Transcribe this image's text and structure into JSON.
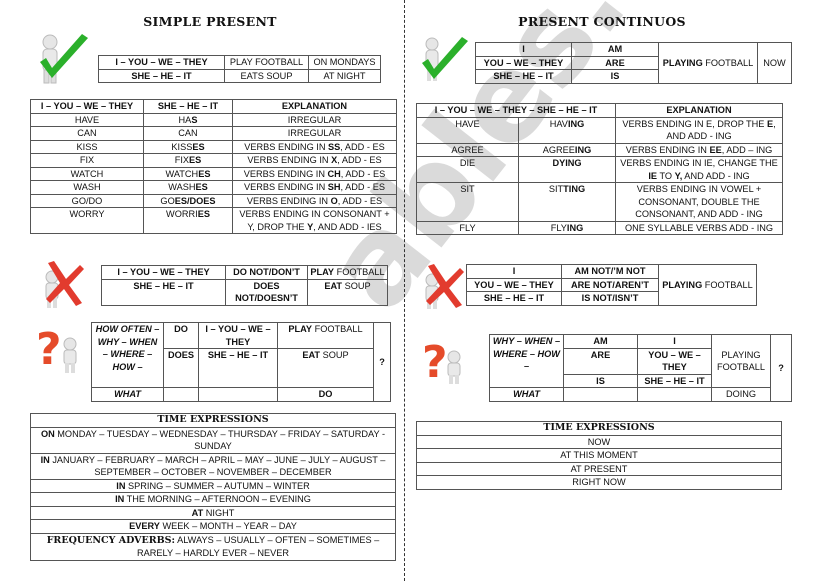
{
  "left": {
    "title": "SIMPLE PRESENT",
    "affirmative": {
      "icon": "person-checkmark-icon",
      "rows": [
        [
          "I – YOU – WE – THEY",
          "PLAY FOOTBALL",
          "ON MONDAYS"
        ],
        [
          "SHE – HE – IT",
          "EATS SOUP",
          "AT NIGHT"
        ]
      ]
    },
    "rules": {
      "headers": [
        "I – YOU – WE – THEY",
        "SHE – HE – IT",
        "EXPLANATION"
      ],
      "rows": [
        {
          "base": "HAVE",
          "third_stem": "HA",
          "third_end": "S",
          "exp_pre": "IRREGULAR",
          "exp_bold": "",
          "exp_post": ""
        },
        {
          "base": "CAN",
          "third_stem": "CAN",
          "third_end": "",
          "exp_pre": "IRREGULAR",
          "exp_bold": "",
          "exp_post": ""
        },
        {
          "base": "KISS",
          "third_stem": "KISS",
          "third_end": "ES",
          "exp_pre": "VERBS ENDING IN ",
          "exp_bold": "SS",
          "exp_post": ", ADD - ES"
        },
        {
          "base": "FIX",
          "third_stem": "FIX",
          "third_end": "ES",
          "exp_pre": "VERBS ENDING IN ",
          "exp_bold": "X",
          "exp_post": ", ADD - ES"
        },
        {
          "base": "WATCH",
          "third_stem": "WATCH",
          "third_end": "ES",
          "exp_pre": "VERBS ENDING IN ",
          "exp_bold": "CH",
          "exp_post": ", ADD - ES"
        },
        {
          "base": "WASH",
          "third_stem": "WASH",
          "third_end": "ES",
          "exp_pre": "VERBS ENDING IN ",
          "exp_bold": "SH",
          "exp_post": ", ADD - ES"
        },
        {
          "base": "GO/DO",
          "third_stem": "GO",
          "third_end": "ES/DOES",
          "exp_pre": "VERBS ENDING IN ",
          "exp_bold": "O",
          "exp_post": ", ADD - ES"
        },
        {
          "base": "WORRY",
          "third_stem": "WORRI",
          "third_end": "ES",
          "exp_pre": "VERBS ENDING IN CONSONANT + Y, DROP THE ",
          "exp_bold": "Y",
          "exp_post": ", AND ADD - IES"
        }
      ]
    },
    "negative": {
      "icon": "person-red-x-icon",
      "row1": {
        "subject": "I – YOU – WE – THEY",
        "aux": "DO NOT/DON’T",
        "verb_bold": "PLAY",
        "verb_rest": " FOOTBALL"
      },
      "row2": {
        "subject": "SHE – HE – IT",
        "aux": "DOES NOT/DOESN’T",
        "verb_bold": "EAT",
        "verb_rest": " SOUP"
      }
    },
    "question": {
      "icon": "person-question-mark-icon",
      "wh": "HOW OFTEN – WHY – WHEN – WHERE – HOW –",
      "wh_what": "WHAT",
      "aux1": "DO",
      "aux2": "DOES",
      "subj1": "I – YOU – WE – THEY",
      "subj2": "SHE – HE – IT",
      "verb1_bold": "PLAY",
      "verb1_rest": " FOOTBALL",
      "verb2_bold": "EAT",
      "verb2_rest": " SOUP",
      "what_verb": "DO",
      "qmark": "?"
    },
    "time": {
      "header": "TIME EXPRESSIONS",
      "rows": [
        {
          "bold": "ON",
          "rest": " MONDAY – TUESDAY – WEDNESDAY – THURSDAY – FRIDAY – SATURDAY - SUNDAY"
        },
        {
          "bold": "IN",
          "rest": " JANUARY – FEBRUARY – MARCH – APRIL – MAY – JUNE – JULY – AUGUST – SEPTEMBER – OCTOBER – NOVEMBER – DECEMBER"
        },
        {
          "bold": "IN",
          "rest": " SPRING – SUMMER – AUTUMN – WINTER"
        },
        {
          "bold": "IN",
          "rest": " THE MORNING – AFTERNOON – EVENING"
        },
        {
          "bold": "AT",
          "rest": " NIGHT"
        },
        {
          "bold": "EVERY",
          "rest": " WEEK – MONTH – YEAR – DAY"
        }
      ],
      "freq_label": "FREQUENCY ADVERBS:",
      "freq_rest": " ALWAYS – USUALLY – OFTEN – SOMETIMES – RARELY – HARDLY EVER – NEVER"
    }
  },
  "right": {
    "title": "PRESENT CONTINUOS",
    "affirmative": {
      "icon": "person-checkmark-icon",
      "subjects": [
        "I",
        "YOU – WE – THEY",
        "SHE – HE – IT"
      ],
      "aux": [
        "AM",
        "ARE",
        "IS"
      ],
      "verb_bold": "PLAYING",
      "verb_rest": " FOOTBALL",
      "time": "NOW"
    },
    "rules": {
      "header1": "I – YOU – WE – THEY – SHE – HE – IT",
      "header2": "EXPLANATION",
      "rows": [
        {
          "base": "HAVE",
          "ing_stem": "HAV",
          "ing_end": "ING",
          "exp": [
            [
              "VERBS ENDING IN E, DROP THE ",
              ""
            ],
            [
              "E",
              "b"
            ],
            [
              ", AND ADD - ING",
              ""
            ]
          ]
        },
        {
          "base": "AGREE",
          "ing_stem": "AGREE",
          "ing_end": "ING",
          "exp": [
            [
              "VERBS ENDING IN ",
              ""
            ],
            [
              "EE",
              "b"
            ],
            [
              ", ADD – ING",
              ""
            ]
          ]
        },
        {
          "base": "DIE",
          "ing_stem": "",
          "ing_end": "DYING",
          "exp": [
            [
              "VERBS ENDING IN IE, CHANGE THE ",
              ""
            ],
            [
              "IE",
              "b"
            ],
            [
              " TO ",
              ""
            ],
            [
              "Y,",
              "b"
            ],
            [
              " AND ADD - ING",
              ""
            ]
          ]
        },
        {
          "base": "SIT",
          "ing_stem": "SIT",
          "ing_end": "TING",
          "exp": [
            [
              "VERBS ENDING IN VOWEL + CONSONANT, DOUBLE THE CONSONANT, AND ADD - ING",
              ""
            ]
          ]
        },
        {
          "base": "FLY",
          "ing_stem": "FLY",
          "ing_end": "ING",
          "exp": [
            [
              "ONE SYLLABLE VERBS ADD - ING",
              ""
            ]
          ]
        }
      ]
    },
    "negative": {
      "icon": "person-red-x-icon",
      "subjects": [
        "I",
        "YOU – WE – THEY",
        "SHE – HE – IT"
      ],
      "aux": [
        "AM NOT/’M NOT",
        "ARE NOT/AREN’T",
        "IS NOT/ISN’T"
      ],
      "verb_bold": "PLAYING",
      "verb_rest": " FOOTBALL"
    },
    "question": {
      "icon": "person-question-mark-icon",
      "wh": "WHY – WHEN – WHERE – HOW –",
      "wh_what": "WHAT",
      "aux": [
        "AM",
        "ARE",
        "IS"
      ],
      "subjects": [
        "I",
        "YOU – WE – THEY",
        "SHE – HE – IT"
      ],
      "verb_bold": "PLAYING",
      "verb_rest": " FOOTBALL",
      "what_verb": "DOING",
      "qmark": "?"
    },
    "time": {
      "header": "TIME EXPRESSIONS",
      "rows": [
        "NOW",
        "AT THIS MOMENT",
        "AT PRESENT",
        "RIGHT NOW"
      ]
    }
  },
  "watermark": "ESLprintables.com",
  "colors": {
    "check": "#2bb02b",
    "cross": "#e23b2e",
    "question": "#e54b2a",
    "border": "#555555"
  }
}
